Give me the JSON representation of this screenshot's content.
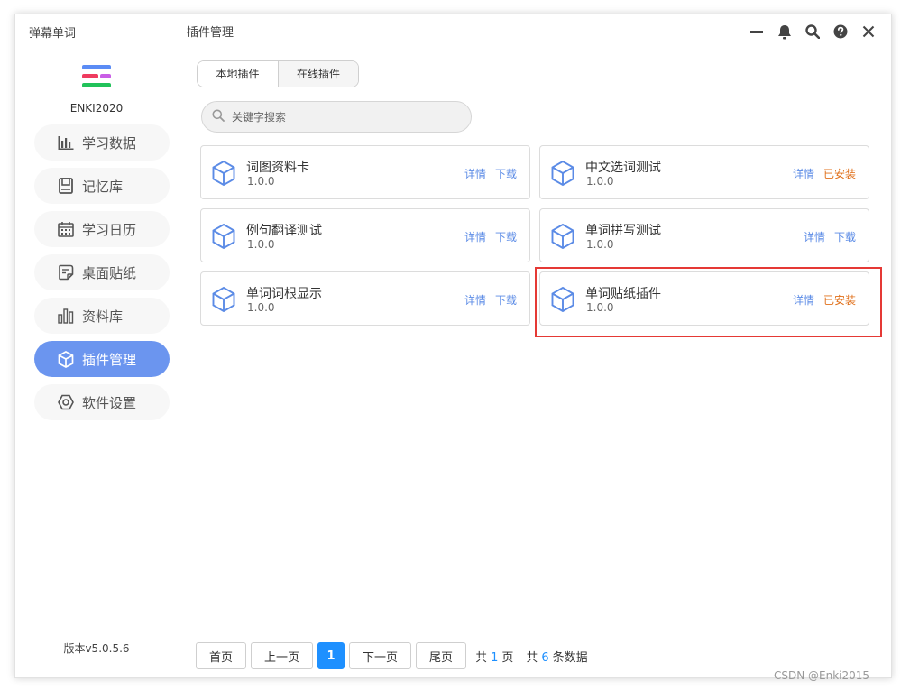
{
  "window": {
    "app_title": "弹幕单词",
    "page_title": "插件管理",
    "controls": [
      "minimize-icon",
      "bell-icon",
      "search-icon",
      "help-icon",
      "close-icon"
    ]
  },
  "user": {
    "name": "ENKI2020"
  },
  "sidebar": {
    "items": [
      {
        "label": "学习数据",
        "icon": "bar-chart-icon",
        "active": false
      },
      {
        "label": "记忆库",
        "icon": "book-icon",
        "active": false
      },
      {
        "label": "学习日历",
        "icon": "calendar-icon",
        "active": false
      },
      {
        "label": "桌面贴纸",
        "icon": "sticker-icon",
        "active": false
      },
      {
        "label": "资料库",
        "icon": "library-icon",
        "active": false
      },
      {
        "label": "插件管理",
        "icon": "plugin-icon",
        "active": true
      },
      {
        "label": "软件设置",
        "icon": "settings-icon",
        "active": false
      }
    ],
    "version": "版本v5.0.5.6"
  },
  "tabs": [
    "本地插件",
    "在线插件"
  ],
  "search": {
    "placeholder": "关键字搜索"
  },
  "plugins": [
    {
      "name": "词图资料卡",
      "version": "1.0.0",
      "detail": "详情",
      "action": "下载",
      "installed": false
    },
    {
      "name": "中文选词测试",
      "version": "1.0.0",
      "detail": "详情",
      "action": "已安装",
      "installed": true
    },
    {
      "name": "例句翻译测试",
      "version": "1.0.0",
      "detail": "详情",
      "action": "下载",
      "installed": false
    },
    {
      "name": "单词拼写测试",
      "version": "1.0.0",
      "detail": "详情",
      "action": "下载",
      "installed": false
    },
    {
      "name": "单词词根显示",
      "version": "1.0.0",
      "detail": "详情",
      "action": "下载",
      "installed": false
    },
    {
      "name": "单词贴纸插件",
      "version": "1.0.0",
      "detail": "详情",
      "action": "已安装",
      "installed": true
    }
  ],
  "pagination": {
    "first": "首页",
    "prev": "上一页",
    "current": "1",
    "next": "下一页",
    "last": "尾页",
    "total_pages_prefix": "共",
    "total_pages": "1",
    "total_pages_suffix": "页",
    "total_items_prefix": "共",
    "total_items": "6",
    "total_items_suffix": "条数据"
  },
  "colors": {
    "accent": "#6b95ef",
    "link": "#5b8be6",
    "installed": "#e0701b",
    "page_active": "#1e90ff",
    "highlight": "#e53935"
  },
  "watermark": "CSDN @Enki2015"
}
